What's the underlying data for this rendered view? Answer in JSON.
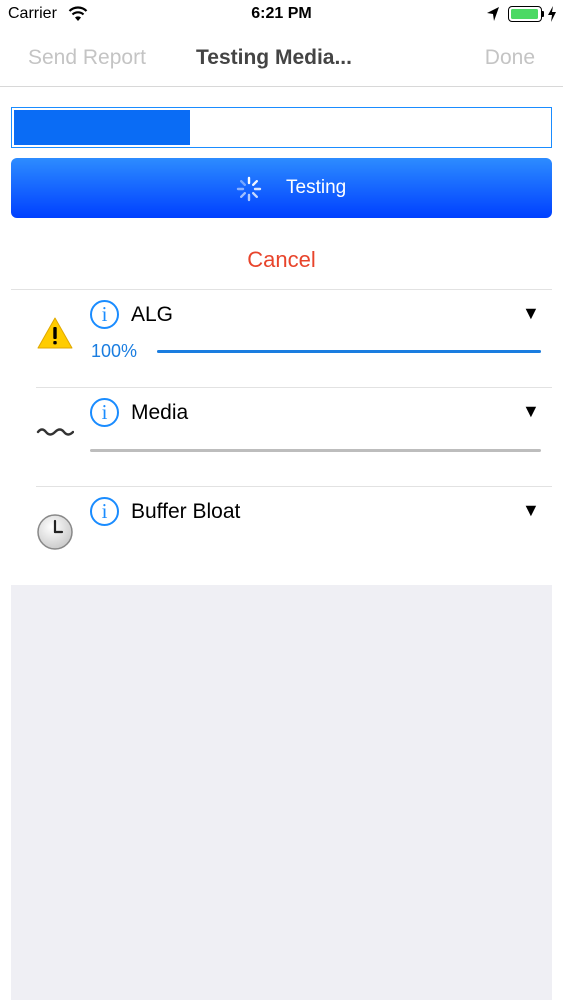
{
  "status_bar": {
    "carrier": "Carrier",
    "time": "6:21 PM",
    "battery_level": 1.0
  },
  "nav": {
    "left": "Send Report",
    "title": "Testing Media...",
    "right": "Done"
  },
  "progress": {
    "value": 0.33
  },
  "testing_button": {
    "label": "Testing"
  },
  "cancel_label": "Cancel",
  "sections": [
    {
      "label": "ALG",
      "status_icon": "warning-icon",
      "percent": "100%",
      "progress": 1.0
    },
    {
      "label": "Media",
      "status_icon": "wave-icon",
      "progress": 0.0
    },
    {
      "label": "Buffer Bloat",
      "status_icon": "clock-icon"
    }
  ],
  "colors": {
    "accent": "#1a8cff",
    "button": "#0a6cf5",
    "cancel": "#e8442b",
    "warning": "#ffcc00",
    "battery": "#4cd964"
  }
}
